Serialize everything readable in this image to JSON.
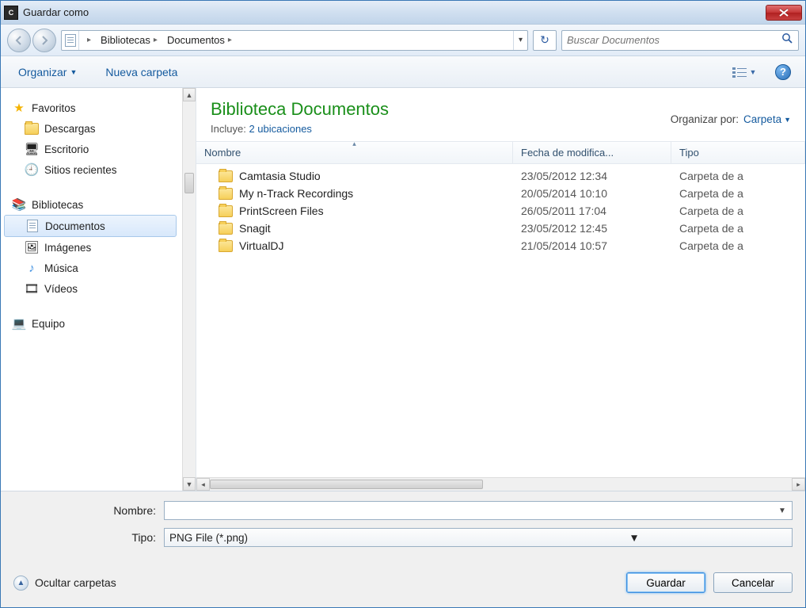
{
  "titlebar": {
    "title": "Guardar como"
  },
  "nav": {
    "crumbs": [
      "Bibliotecas",
      "Documentos"
    ],
    "search_placeholder": "Buscar Documentos"
  },
  "toolbar": {
    "organize": "Organizar",
    "new_folder": "Nueva carpeta"
  },
  "sidebar": {
    "favorites": {
      "label": "Favoritos",
      "items": [
        "Descargas",
        "Escritorio",
        "Sitios recientes"
      ]
    },
    "libraries": {
      "label": "Bibliotecas",
      "items": [
        "Documentos",
        "Imágenes",
        "Música",
        "Vídeos"
      ],
      "selected": 0
    },
    "computer": {
      "label": "Equipo"
    }
  },
  "library": {
    "title": "Biblioteca Documentos",
    "includes_label": "Incluye:",
    "includes_link": "2 ubicaciones",
    "organize_by_label": "Organizar por:",
    "organize_by_value": "Carpeta"
  },
  "columns": {
    "name": "Nombre",
    "date": "Fecha de modifica...",
    "type": "Tipo"
  },
  "rows": [
    {
      "name": "Camtasia Studio",
      "date": "23/05/2012 12:34",
      "type": "Carpeta de a"
    },
    {
      "name": "My n-Track Recordings",
      "date": "20/05/2014 10:10",
      "type": "Carpeta de a"
    },
    {
      "name": "PrintScreen Files",
      "date": "26/05/2011 17:04",
      "type": "Carpeta de a"
    },
    {
      "name": "Snagit",
      "date": "23/05/2012 12:45",
      "type": "Carpeta de a"
    },
    {
      "name": "VirtualDJ",
      "date": "21/05/2014 10:57",
      "type": "Carpeta de a"
    }
  ],
  "form": {
    "name_label": "Nombre:",
    "name_value": "",
    "type_label": "Tipo:",
    "type_value": "PNG File (*.png)"
  },
  "footer": {
    "hide_folders": "Ocultar carpetas",
    "save": "Guardar",
    "cancel": "Cancelar"
  }
}
